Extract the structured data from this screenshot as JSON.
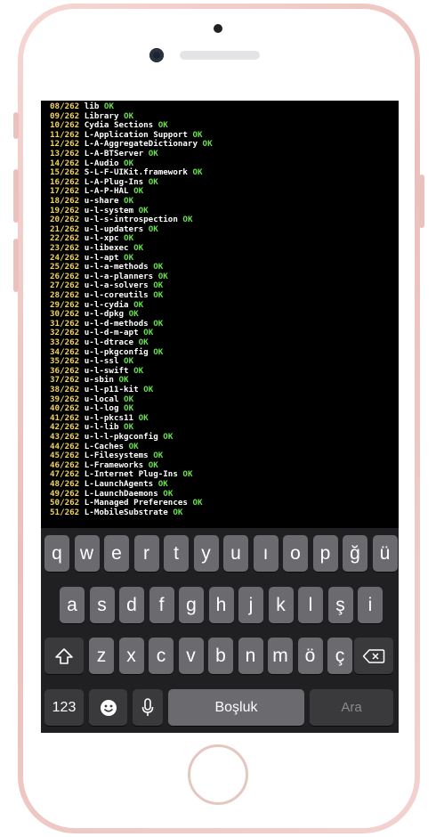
{
  "terminal": {
    "lines": [
      {
        "n": "08/262",
        "t": "lib",
        "s": "OK"
      },
      {
        "n": "09/262",
        "t": "Library",
        "s": "OK"
      },
      {
        "n": "10/262",
        "t": "Cydia Sections",
        "s": "OK"
      },
      {
        "n": "11/262",
        "t": "L-Application Support",
        "s": "OK"
      },
      {
        "n": "12/262",
        "t": "L-A-AggregateDictionary",
        "s": "OK"
      },
      {
        "n": "13/262",
        "t": "L-A-BTServer",
        "s": "OK"
      },
      {
        "n": "14/262",
        "t": "L-Audio",
        "s": "OK"
      },
      {
        "n": "15/262",
        "t": "S-L-F-UIKit.framework",
        "s": "OK"
      },
      {
        "n": "16/262",
        "t": "L-A-Plug-Ins",
        "s": "OK"
      },
      {
        "n": "17/262",
        "t": "L-A-P-HAL",
        "s": "OK"
      },
      {
        "n": "18/262",
        "t": "u-share",
        "s": "OK"
      },
      {
        "n": "19/262",
        "t": "u-l-system",
        "s": "OK"
      },
      {
        "n": "20/262",
        "t": "u-l-s-introspection",
        "s": "OK"
      },
      {
        "n": "21/262",
        "t": "u-l-updaters",
        "s": "OK"
      },
      {
        "n": "22/262",
        "t": "u-l-xpc",
        "s": "OK"
      },
      {
        "n": "23/262",
        "t": "u-libexec",
        "s": "OK"
      },
      {
        "n": "24/262",
        "t": "u-l-apt",
        "s": "OK"
      },
      {
        "n": "25/262",
        "t": "u-l-a-methods",
        "s": "OK"
      },
      {
        "n": "26/262",
        "t": "u-l-a-planners",
        "s": "OK"
      },
      {
        "n": "27/262",
        "t": "u-l-a-solvers",
        "s": "OK"
      },
      {
        "n": "28/262",
        "t": "u-l-coreutils",
        "s": "OK"
      },
      {
        "n": "29/262",
        "t": "u-l-cydia",
        "s": "OK"
      },
      {
        "n": "30/262",
        "t": "u-l-dpkg",
        "s": "OK"
      },
      {
        "n": "31/262",
        "t": "u-l-d-methods",
        "s": "OK"
      },
      {
        "n": "32/262",
        "t": "u-l-d-m-apt",
        "s": "OK"
      },
      {
        "n": "33/262",
        "t": "u-l-dtrace",
        "s": "OK"
      },
      {
        "n": "34/262",
        "t": "u-l-pkgconfig",
        "s": "OK"
      },
      {
        "n": "35/262",
        "t": "u-l-ssl",
        "s": "OK"
      },
      {
        "n": "36/262",
        "t": "u-l-swift",
        "s": "OK"
      },
      {
        "n": "37/262",
        "t": "u-sbin",
        "s": "OK"
      },
      {
        "n": "38/262",
        "t": "u-l-p11-kit",
        "s": "OK"
      },
      {
        "n": "39/262",
        "t": "u-local",
        "s": "OK"
      },
      {
        "n": "40/262",
        "t": "u-l-log",
        "s": "OK"
      },
      {
        "n": "41/262",
        "t": "u-l-pkcs11",
        "s": "OK"
      },
      {
        "n": "42/262",
        "t": "u-l-lib",
        "s": "OK"
      },
      {
        "n": "43/262",
        "t": "u-l-l-pkgconfig",
        "s": "OK"
      },
      {
        "n": "44/262",
        "t": "L-Caches",
        "s": "OK"
      },
      {
        "n": "45/262",
        "t": "L-Filesystems",
        "s": "OK"
      },
      {
        "n": "46/262",
        "t": "L-Frameworks",
        "s": "OK"
      },
      {
        "n": "47/262",
        "t": "L-Internet Plug-Ins",
        "s": "OK"
      },
      {
        "n": "48/262",
        "t": "L-LaunchAgents",
        "s": "OK"
      },
      {
        "n": "49/262",
        "t": "L-LaunchDaemons",
        "s": "OK"
      },
      {
        "n": "50/262",
        "t": "L-Managed Preferences",
        "s": "OK"
      },
      {
        "n": "51/262",
        "t": "L-MobileSubstrate",
        "s": "OK"
      }
    ]
  },
  "keyboard": {
    "row1": [
      "q",
      "w",
      "e",
      "r",
      "t",
      "y",
      "u",
      "ı",
      "o",
      "p",
      "ğ",
      "ü"
    ],
    "row2": [
      "a",
      "s",
      "d",
      "f",
      "g",
      "h",
      "j",
      "k",
      "l",
      "ş",
      "i"
    ],
    "row3": [
      "z",
      "x",
      "c",
      "v",
      "b",
      "n",
      "m",
      "ö",
      "ç"
    ],
    "shift_icon": "shift-arrow-icon",
    "backspace_icon": "backspace-icon",
    "numbers_label": "123",
    "emoji_icon": "emoji-icon",
    "mic_icon": "microphone-icon",
    "space_label": "Boşluk",
    "search_label": "Ara"
  },
  "colors": {
    "line_number": "#f2d35c",
    "text": "#ffffff",
    "status_ok": "#67e04d",
    "phone_body": "#f0c9c5"
  }
}
